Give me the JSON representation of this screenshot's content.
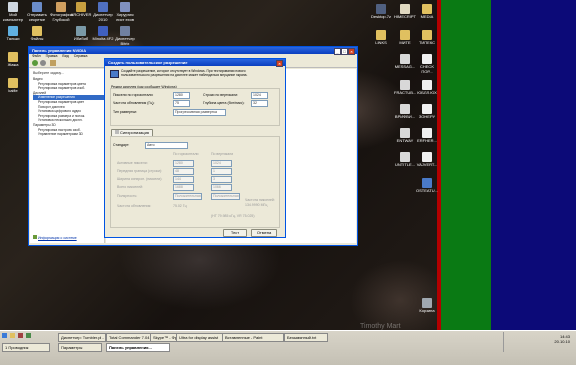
{
  "desktop_icons_left": [
    {
      "label": "Мой компьютер",
      "color": "#cfd8e0"
    },
    {
      "label": "Отправить секретке",
      "color": "#6a8cc8"
    },
    {
      "label": "Фотографии Глубокой",
      "color": "#d0a060"
    },
    {
      "label": "ARCHIVER",
      "color": "#c8a040"
    },
    {
      "label": "Диспетчер 2010",
      "color": "#5070c0"
    },
    {
      "label": "Хирургия лист ехов",
      "color": "#8090c0"
    },
    {
      "label": "Тальки",
      "color": "#60b0e0"
    },
    {
      "label": "Файлы",
      "color": "#e0c060"
    },
    {
      "label": "Ибибиб",
      "color": "#7a9aa8"
    },
    {
      "label": "Minolta 4F2",
      "color": "#4060c0"
    },
    {
      "label": "Диспетчер Bitrix",
      "color": "#7080a0"
    },
    {
      "label": "Жажа",
      "color": "#e0c060"
    },
    {
      "label": "kaifie",
      "color": "#e0c060"
    }
  ],
  "desktop_icons_right": [
    {
      "label": "Desktop.7z",
      "color": "#506080"
    },
    {
      "label": "HIMECRIPT",
      "color": "#e0d8c0"
    },
    {
      "label": "MEDIA",
      "color": "#e0c060"
    },
    {
      "label": "LINKS",
      "color": "#e0c060"
    },
    {
      "label": "МИТЕ",
      "color": "#e0c060"
    },
    {
      "label": "ТИПЕКС",
      "color": "#e0c060"
    },
    {
      "label": "MESSAG...",
      "color": "#d8d8d8"
    },
    {
      "label": "CHECK ПОР...",
      "color": "#f0f0f0"
    },
    {
      "label": "FRACTUB...",
      "color": "#d8d8d8"
    },
    {
      "label": "ЮБЛЛ.ЮХ",
      "color": "#f0f0f0"
    },
    {
      "label": "ВРИФВИ...",
      "color": "#d8d8d8"
    },
    {
      "label": "ЗОНЕРУ",
      "color": "#f0f0f0"
    },
    {
      "label": "ENTWAY",
      "color": "#d8d8d8"
    },
    {
      "label": "ERFHER...",
      "color": "#f0f0f0"
    },
    {
      "label": "UNTITLE...",
      "color": "#d8d8d8"
    },
    {
      "label": "VAJVERT...",
      "color": "#f0f0f0"
    },
    {
      "label": "OSTEATU...",
      "color": "#4a7ac8"
    },
    {
      "label": "Корзина",
      "color": "#a0a8b0"
    }
  ],
  "nvidia_window": {
    "title": "Панель управления NVIDIA",
    "menu": [
      "Файл",
      "Правка",
      "Вид",
      "Справка"
    ],
    "sidebar_header": "Выберите задачу...",
    "tree": [
      "Видео",
      "Регулировка параметров цвета",
      "Регулировка параметров изоб.",
      "Дисплей",
      "Изменение разрешения",
      "Регулировка параметров цвет",
      "Поворот дисплея",
      "Установка цифрового аудио",
      "Регулировка размера и полож.",
      "Установка нескольких диспл.",
      "Параметры 3D",
      "Регулировка настроек изоб.",
      "Управление параметрами 3D"
    ],
    "footer_link": "Информация о системе"
  },
  "dialog": {
    "title": "Создать пользовательское разрешение",
    "description": "Создайте разрешение, которое отсутствует в Windows. При тестировании нового пользовательского разрешения на дисплее может наблюдаться мерцание экрана.",
    "group_label": "Режим дисплея (как сообщает Windows)",
    "h_pixels_label": "Пиксели по горизонтали:",
    "h_pixels_value": "1280",
    "v_lines_label": "Строки по вертикали:",
    "v_lines_value": "1024",
    "refresh_label": "Частота обновления (Гц):",
    "refresh_value": "75",
    "color_depth_label": "Глубина цвета (бит/пикс):",
    "color_depth_value": "32",
    "scan_label": "Тип развертки:",
    "scan_value": "Прогрессивная развертка",
    "timing_toggle": "Синхронизация",
    "standard_label": "Стандарт:",
    "standard_value": "Авто",
    "col_horizontal": "По горизонтали",
    "col_vertical": "По вертикали",
    "timing_rows": [
      {
        "label": "Активные пиксели:",
        "h": "1280",
        "v": "1024"
      },
      {
        "label": "Передняя граница (строки):",
        "h": "48",
        "v": "1"
      },
      {
        "label": "Ширина синхрон. (пиксели):",
        "h": "144",
        "v": "3"
      },
      {
        "label": "Всего пикселей:",
        "h": "1688",
        "v": "1066"
      }
    ],
    "polarity_label": "Полярность:",
    "polarity_h": "Положительная",
    "polarity_v": "Положительная",
    "refresh_rate_label": "Частота обновления:",
    "refresh_rate_value": "75.02 Гц",
    "pixel_clock_label": "Частота пикселей:",
    "pixel_clock_value": "134.9990 МГц",
    "summary": "(HT 79.985 кГц, VR 75.025)",
    "test_button": "Тест",
    "cancel_button": "Отмена"
  },
  "taskbar": {
    "tasks": [
      {
        "label": "1 Проводник",
        "active": false
      },
      {
        "label": "Диспетчер: Tumbler.pl - ...",
        "active": false
      },
      {
        "label": "Total Commander 7.04 ...",
        "active": false
      },
      {
        "label": "Skype™ - Фрейм ...",
        "active": false
      },
      {
        "label": "Ultra for display assist",
        "active": false
      },
      {
        "label": "Вставленные - Paint",
        "active": false
      },
      {
        "label": "Безымянный.txt",
        "active": false
      },
      {
        "label": "Панель управления...",
        "active": true
      },
      {
        "label": "Параметры",
        "active": false
      }
    ],
    "clock_time": "14:43",
    "clock_date": "20.10.10",
    "watermark": "Timothy Mart"
  }
}
